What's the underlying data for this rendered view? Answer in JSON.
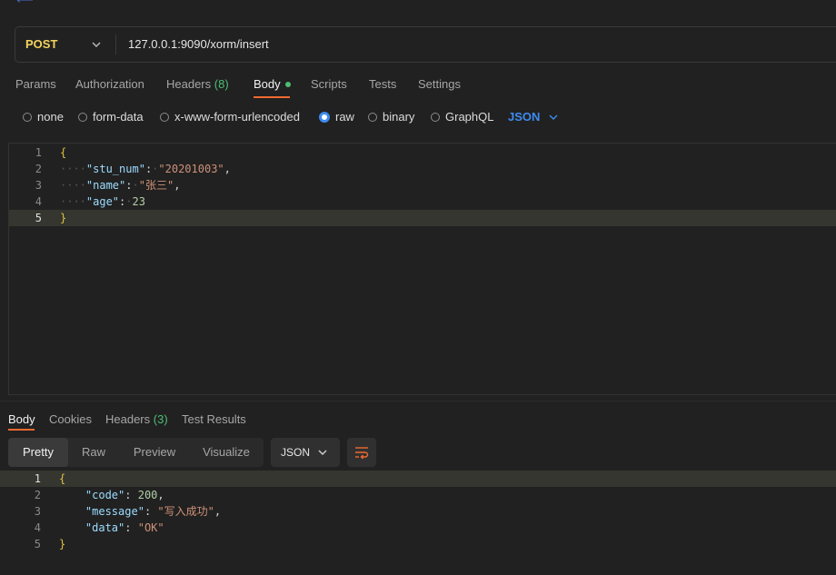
{
  "request": {
    "method": "POST",
    "url": "127.0.0.1:9090/xorm/insert",
    "tabs": [
      {
        "label": "Params"
      },
      {
        "label": "Authorization"
      },
      {
        "label": "Headers",
        "count": "(8)"
      },
      {
        "label": "Body"
      },
      {
        "label": "Scripts"
      },
      {
        "label": "Tests"
      },
      {
        "label": "Settings"
      }
    ],
    "active_tab": "Body",
    "body_modes": [
      "none",
      "form-data",
      "x-www-form-urlencoded",
      "raw",
      "binary",
      "GraphQL"
    ],
    "selected_body_mode": "raw",
    "body_language": "JSON",
    "body_lines": [
      {
        "num": "1",
        "text": "{"
      },
      {
        "num": "2",
        "key": "\"stu_num\"",
        "value": "\"20201003\"",
        "trail": ","
      },
      {
        "num": "3",
        "key": "\"name\"",
        "value": "\"张三\"",
        "trail": ","
      },
      {
        "num": "4",
        "key": "\"age\"",
        "value": "23",
        "trail": ""
      },
      {
        "num": "5",
        "text": "}"
      }
    ]
  },
  "response": {
    "tabs": [
      {
        "label": "Body"
      },
      {
        "label": "Cookies"
      },
      {
        "label": "Headers",
        "count": "(3)"
      },
      {
        "label": "Test Results"
      }
    ],
    "active_tab": "Body",
    "views": [
      "Pretty",
      "Raw",
      "Preview",
      "Visualize"
    ],
    "active_view": "Pretty",
    "format": "JSON",
    "body_lines": [
      {
        "num": "1",
        "text": "{"
      },
      {
        "num": "2",
        "key": "\"code\"",
        "value": "200",
        "trail": ","
      },
      {
        "num": "3",
        "key": "\"message\"",
        "value": "\"写入成功\"",
        "trail": ","
      },
      {
        "num": "4",
        "key": "\"data\"",
        "value": "\"OK\"",
        "trail": ""
      },
      {
        "num": "5",
        "text": "}"
      }
    ]
  },
  "colors": {
    "method": "#f2d45c",
    "accent_underline": "#f06a2f",
    "radio_checked": "#3d8bf0",
    "status_dot": "#4dbd74"
  },
  "icons": [
    "back-arrow-icon",
    "chevron-down-icon",
    "wrap-lines-icon"
  ]
}
